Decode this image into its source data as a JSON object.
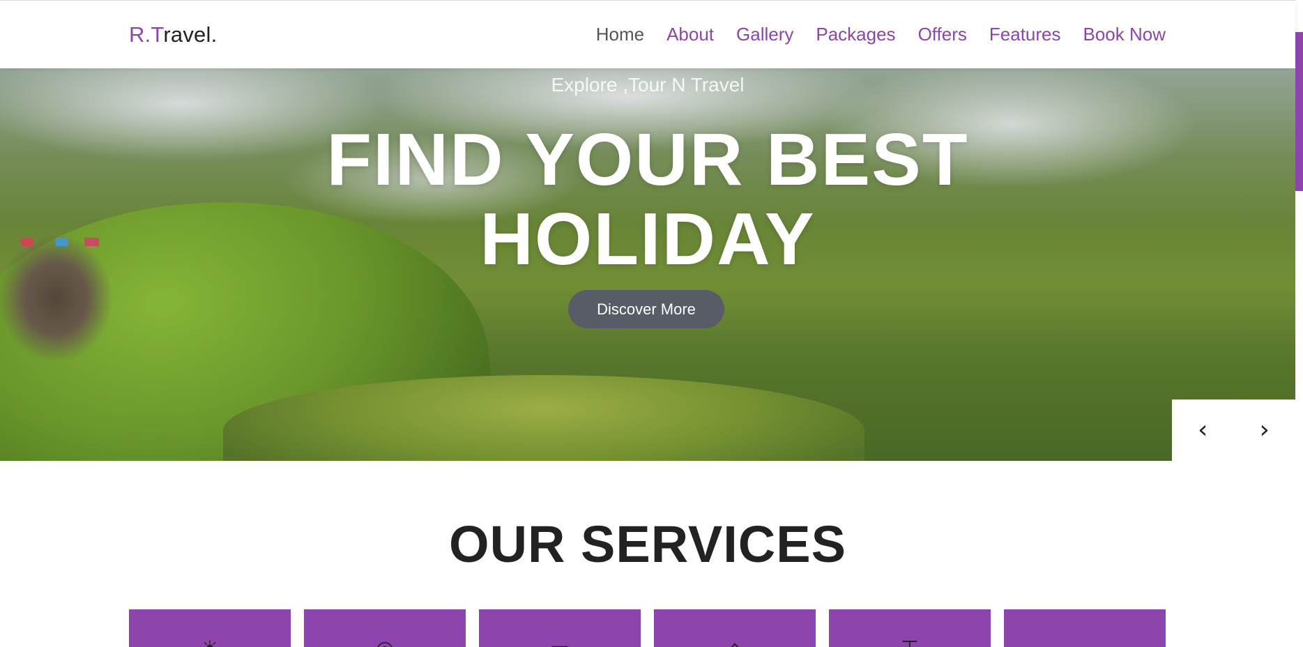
{
  "logo": {
    "accent": "R.T",
    "rest": "ravel."
  },
  "nav": [
    {
      "label": "Home",
      "active": true
    },
    {
      "label": "About"
    },
    {
      "label": "Gallery"
    },
    {
      "label": "Packages"
    },
    {
      "label": "Offers"
    },
    {
      "label": "Features"
    },
    {
      "label": "Book Now"
    }
  ],
  "hero": {
    "subtitle": "Explore ,Tour N Travel",
    "title_line1": "FIND YOUR BEST",
    "title_line2": "HOLIDAY",
    "button_label": "Discover More",
    "prev_icon": "‹",
    "next_icon": "›"
  },
  "services": {
    "title": "OUR SERVICES",
    "cards": [
      {
        "icon": "sun-icon",
        "glyph": "☀"
      },
      {
        "icon": "map-pin-icon",
        "glyph": "◎"
      },
      {
        "icon": "bus-icon",
        "glyph": "▭"
      },
      {
        "icon": "home-icon",
        "glyph": "⌂"
      },
      {
        "icon": "briefcase-icon",
        "glyph": "⊤"
      },
      {
        "icon": "unknown-icon",
        "glyph": ""
      }
    ]
  },
  "colors": {
    "accent": "#8e44ad",
    "button": "#575c66",
    "heading": "#222222"
  }
}
